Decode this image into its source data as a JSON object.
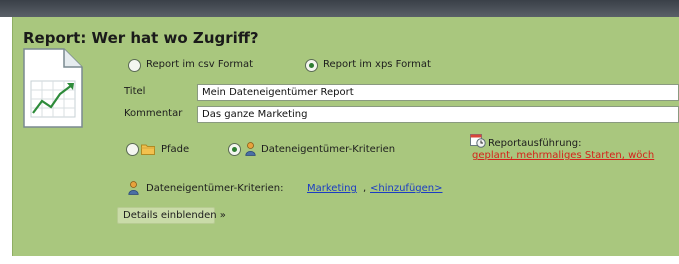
{
  "panel": {
    "title": "Report: Wer hat wo Zugriff?"
  },
  "format": {
    "csv_label": "Report im csv Format",
    "xps_label": "Report im xps Format",
    "selected": "xps"
  },
  "form": {
    "titel_label": "Titel",
    "titel_value": "Mein Dateneigentümer Report",
    "kommentar_label": "Kommentar",
    "kommentar_value": "Das ganze Marketing"
  },
  "scope": {
    "pfade_label": "Pfade",
    "kriterien_label": "Dateneigentümer-Kriterien",
    "selected": "kriterien"
  },
  "schedule": {
    "label": "Reportausführung:",
    "value": "geplant, mehrmaliges Starten, wöch"
  },
  "criteria": {
    "label": "Dateneigentümer-Kriterien:",
    "marketing_link": "Marketing",
    "separator": ",",
    "add_link": "<hinzufügen>"
  },
  "details": {
    "label": "Details einblenden »"
  },
  "icons": {
    "report": "report-chart-icon",
    "folder": "folder-icon",
    "owner": "data-owner-icon",
    "schedule": "schedule-icon"
  },
  "colors": {
    "panel_bg": "#a9c77e",
    "link_blue": "#1b3cc4",
    "link_red": "#d4221a"
  }
}
